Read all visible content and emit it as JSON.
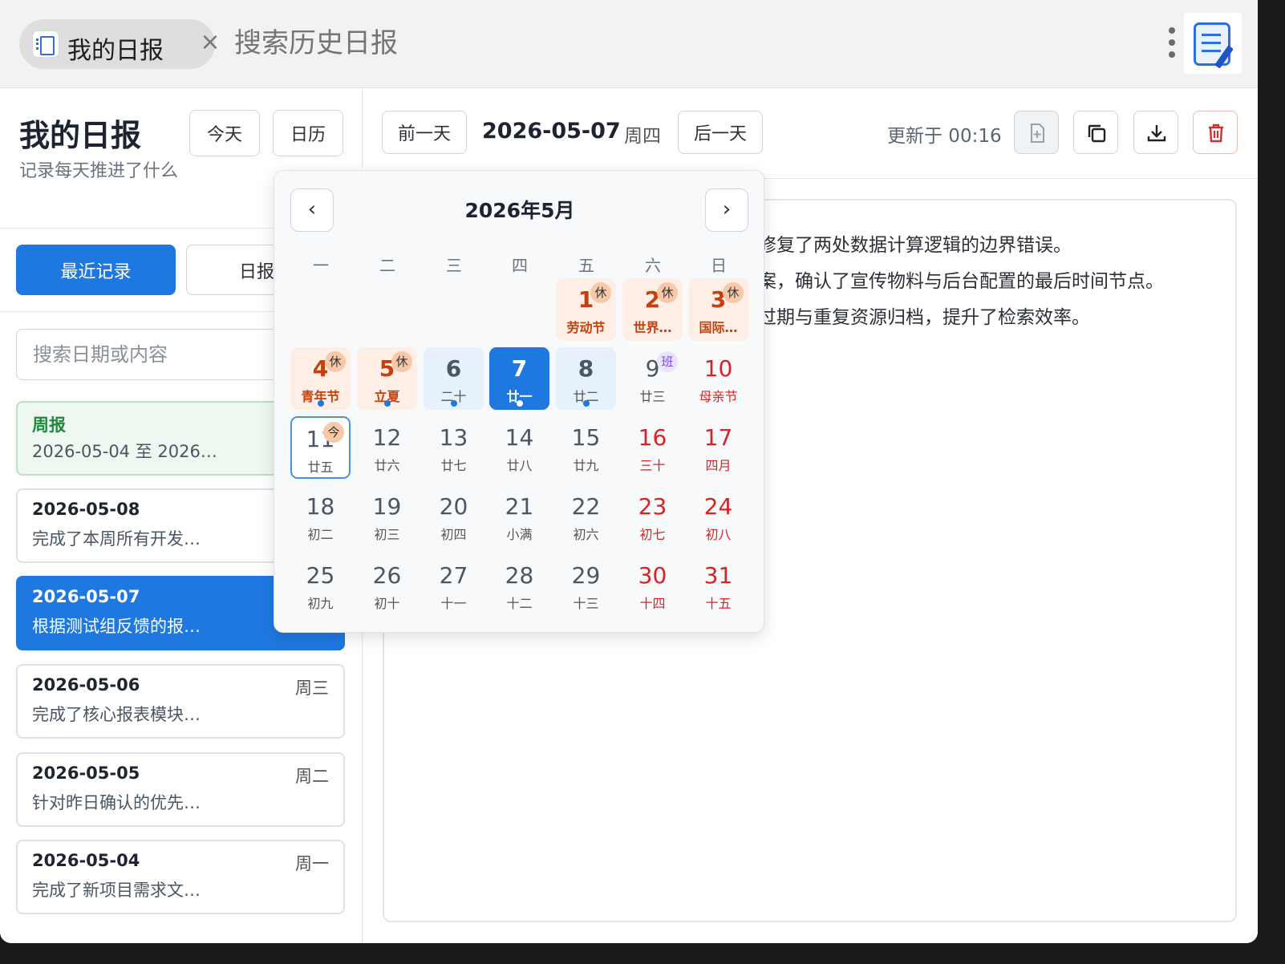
{
  "tab": {
    "title": "我的日报"
  },
  "search_history": {
    "placeholder": "搜索历史日报"
  },
  "sidebar": {
    "title": "我的日报",
    "subtitle": "记录每天推进了什么",
    "today_label": "今天",
    "calendar_label": "日历",
    "tabs": [
      {
        "label": "最近记录"
      },
      {
        "label": "日报模"
      }
    ],
    "filter_placeholder": "搜索日期或内容",
    "cards": [
      {
        "date": "周报",
        "summary": "2026-05-04 至 2026…",
        "weekday": ""
      },
      {
        "date": "2026-05-08",
        "summary": "完成了本周所有开发…",
        "weekday": ""
      },
      {
        "date": "2026-05-07",
        "summary": "根据测试组反馈的报…",
        "weekday": ""
      },
      {
        "date": "2026-05-06",
        "summary": "完成了核心报表模块…",
        "weekday": "周三"
      },
      {
        "date": "2026-05-05",
        "summary": "针对昨日确认的优先…",
        "weekday": "周二"
      },
      {
        "date": "2026-05-04",
        "summary": "完成了新项目需求文…",
        "weekday": "周一"
      }
    ]
  },
  "header": {
    "prev_label": "前一天",
    "date": "2026-05-07",
    "weekday": "周四",
    "next_label": "后一天",
    "updated": "更新于 00:16"
  },
  "editor": {
    "lines": [
      "修复了两处数据计算逻辑的边界错误。",
      "案，确认了宣传物料与后台配置的最后时间节点。",
      "过期与重复资源归档，提升了检索效率。"
    ]
  },
  "calendar": {
    "title": "2026年5月",
    "prev": "‹",
    "next": "›",
    "weekdays": [
      "一",
      "二",
      "三",
      "四",
      "五",
      "六",
      "日"
    ],
    "rows": [
      [
        null,
        null,
        null,
        null,
        {
          "n": "1",
          "l": "劳动节",
          "badge": "休",
          "type": "holiday"
        },
        {
          "n": "2",
          "l": "世界…",
          "badge": "休",
          "type": "holiday"
        },
        {
          "n": "3",
          "l": "国际…",
          "badge": "休",
          "type": "holiday"
        }
      ],
      [
        {
          "n": "4",
          "l": "青年节",
          "badge": "休",
          "type": "holiday",
          "dot": true
        },
        {
          "n": "5",
          "l": "立夏",
          "badge": "休",
          "type": "holiday",
          "dot": true
        },
        {
          "n": "6",
          "l": "二十",
          "type": "has",
          "dot": true
        },
        {
          "n": "7",
          "l": "廿一",
          "type": "sel",
          "dot": true
        },
        {
          "n": "8",
          "l": "廿二",
          "type": "has",
          "dot": true
        },
        {
          "n": "9",
          "l": "廿三",
          "badge": "班",
          "type": "work"
        },
        {
          "n": "10",
          "l": "母亲节",
          "type": "red"
        }
      ],
      [
        {
          "n": "11",
          "l": "廿五",
          "badge": "今",
          "type": "today"
        },
        {
          "n": "12",
          "l": "廿六"
        },
        {
          "n": "13",
          "l": "廿七"
        },
        {
          "n": "14",
          "l": "廿八"
        },
        {
          "n": "15",
          "l": "廿九"
        },
        {
          "n": "16",
          "l": "三十",
          "type": "red"
        },
        {
          "n": "17",
          "l": "四月",
          "type": "red"
        }
      ],
      [
        {
          "n": "18",
          "l": "初二"
        },
        {
          "n": "19",
          "l": "初三"
        },
        {
          "n": "20",
          "l": "初四"
        },
        {
          "n": "21",
          "l": "小满"
        },
        {
          "n": "22",
          "l": "初六"
        },
        {
          "n": "23",
          "l": "初七",
          "type": "red"
        },
        {
          "n": "24",
          "l": "初八",
          "type": "red"
        }
      ],
      [
        {
          "n": "25",
          "l": "初九"
        },
        {
          "n": "26",
          "l": "初十"
        },
        {
          "n": "27",
          "l": "十一"
        },
        {
          "n": "28",
          "l": "十二"
        },
        {
          "n": "29",
          "l": "十三"
        },
        {
          "n": "30",
          "l": "十四",
          "type": "red"
        },
        {
          "n": "31",
          "l": "十五",
          "type": "red"
        }
      ]
    ]
  },
  "colors": {
    "accent": "#1f78e0",
    "holiday": "#c4400e",
    "weekend": "#d92323",
    "weekly": "#1f8a3e"
  }
}
